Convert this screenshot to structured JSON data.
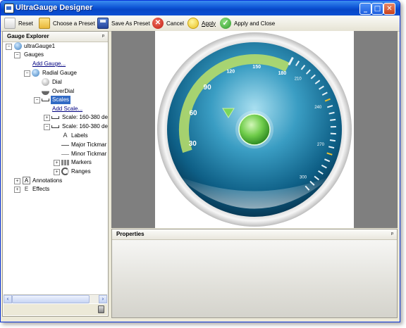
{
  "window": {
    "title": "UltraGauge Designer"
  },
  "titlebar": {
    "minimize": "_",
    "maximize": "□",
    "close": "✕"
  },
  "toolbar": {
    "reset": "Reset",
    "choose_preset": "Choose a Preset",
    "save_preset": "Save As Preset",
    "cancel": "Cancel",
    "apply": "Apply",
    "apply_close": "Apply and Close"
  },
  "explorer": {
    "title": "Gauge Explorer",
    "pin": "ᵖ",
    "tree": {
      "root": "ultraGauge1",
      "gauges": "Gauges",
      "add_gauge": "Add Gauge...",
      "radial_gauge": "Radial Gauge",
      "dial": "Dial",
      "overdial": "OverDial",
      "scales": "Scales",
      "add_scale": "Add Scale...",
      "scale1": "Scale: 160-380 de",
      "scale2": "Scale: 160-380 de",
      "labels": "Labels",
      "major_tickmarks": "Major Tickmar",
      "minor_tickmarks": "Minor Tickmar",
      "markers": "Markers",
      "ranges": "Ranges",
      "annotations": "Annotations",
      "effects": "Effects"
    }
  },
  "properties": {
    "title": "Properties",
    "pin": "ᵖ"
  },
  "gauge": {
    "labels_inner": [
      "30",
      "60",
      "90",
      "120",
      "150",
      "180"
    ],
    "labels_outer": [
      "210",
      "240",
      "270",
      "300"
    ],
    "colors": {
      "range": "#b5dc6a",
      "face": "#1a7fa8",
      "needle": "#7ad65a",
      "accent_ticks": "#e8c030"
    }
  }
}
